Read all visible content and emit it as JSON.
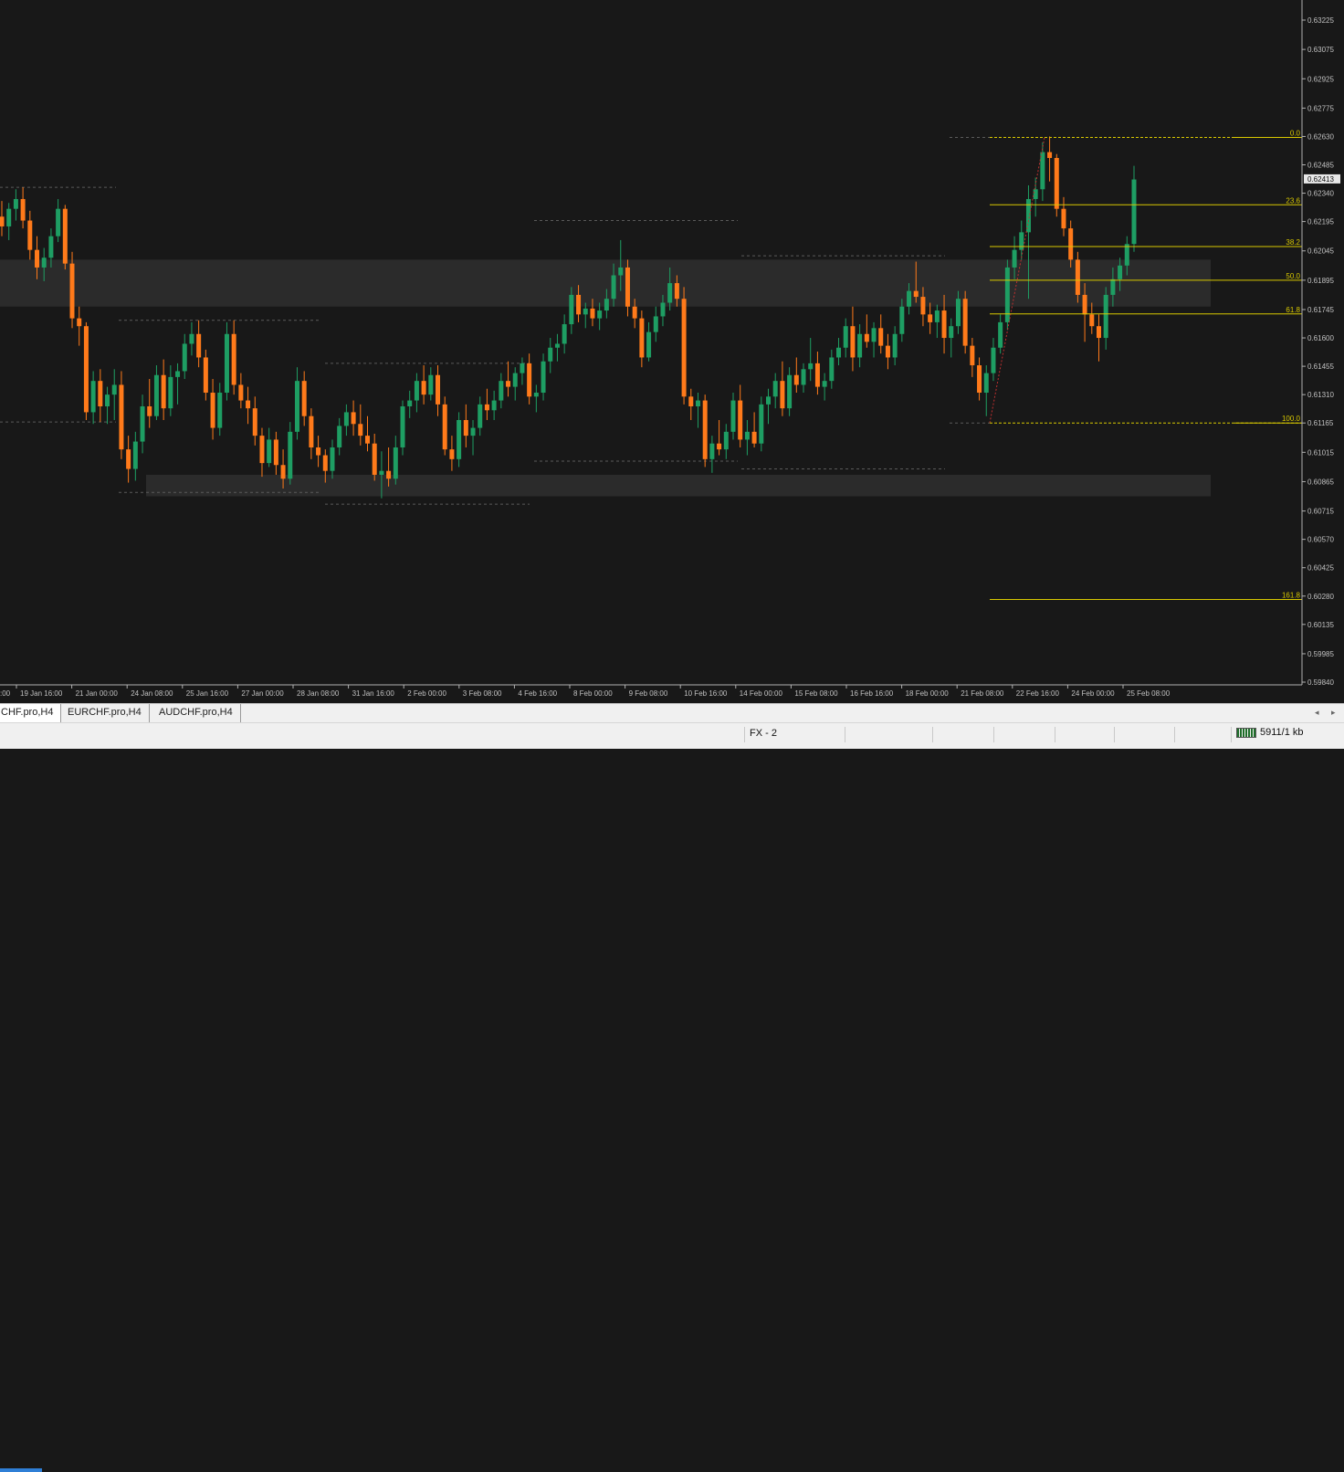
{
  "colors": {
    "background": "#181818",
    "bull": "#1e9e63",
    "bear": "#ff7a1a",
    "fib": "#d8c800",
    "zone": "#2b2b2b",
    "axis_text": "#c0c0c0",
    "price_marker_bg": "#e8e8e8"
  },
  "chart_data": {
    "type": "candlestick",
    "symbol_tabs_hint": "H4",
    "ylim": [
      0.5984,
      0.633
    ],
    "price_ticks": [
      "0.63225",
      "0.63075",
      "0.62925",
      "0.62775",
      "0.62630",
      "0.62485",
      "0.62340",
      "0.62195",
      "0.62045",
      "0.61895",
      "0.61745",
      "0.61600",
      "0.61455",
      "0.61310",
      "0.61165",
      "0.61015",
      "0.60865",
      "0.60715",
      "0.60570",
      "0.60425",
      "0.60280",
      "0.60135",
      "0.59985",
      "0.59840"
    ],
    "current_price": "0.62413",
    "time_labels": [
      "19 Jan 16:00",
      "21 Jan 00:00",
      "24 Jan 08:00",
      "25 Jan 16:00",
      "27 Jan 00:00",
      "28 Jan 08:00",
      "31 Jan 16:00",
      "2 Feb 00:00",
      "3 Feb 08:00",
      "4 Feb 16:00",
      "8 Feb 00:00",
      "9 Feb 08:00",
      "10 Feb 16:00",
      "14 Feb 00:00",
      "15 Feb 08:00",
      "16 Feb 16:00",
      "18 Feb 00:00",
      "21 Feb 08:00",
      "22 Feb 16:00",
      "24 Feb 00:00",
      "25 Feb 08:00"
    ],
    "first_time_label_fragment": ":00",
    "fibonacci": {
      "high": 0.62625,
      "low": 0.61165,
      "levels": [
        {
          "label": "0.0",
          "ratio": 0
        },
        {
          "label": "23.6",
          "ratio": 0.236
        },
        {
          "label": "38.2",
          "ratio": 0.382
        },
        {
          "label": "50.0",
          "ratio": 0.5
        },
        {
          "label": "61.8",
          "ratio": 0.618
        },
        {
          "label": "100.0",
          "ratio": 1.0
        },
        {
          "label": "161.8",
          "ratio": 1.618
        }
      ]
    },
    "zones": [
      {
        "name": "resistance-zone",
        "from": 0.6176,
        "to": 0.62
      },
      {
        "name": "support-zone",
        "from": 0.6079,
        "to": 0.609
      }
    ],
    "candles": [
      [
        0.6222,
        0.623,
        0.6212,
        0.6217
      ],
      [
        0.6217,
        0.6229,
        0.621,
        0.6226
      ],
      [
        0.6226,
        0.6236,
        0.622,
        0.6231
      ],
      [
        0.6231,
        0.6237,
        0.6216,
        0.622
      ],
      [
        0.622,
        0.6225,
        0.62,
        0.6205
      ],
      [
        0.6205,
        0.6212,
        0.619,
        0.6196
      ],
      [
        0.6196,
        0.6206,
        0.6189,
        0.6201
      ],
      [
        0.6201,
        0.6216,
        0.6196,
        0.6212
      ],
      [
        0.6212,
        0.6231,
        0.6209,
        0.6226
      ],
      [
        0.6226,
        0.6228,
        0.6195,
        0.6198
      ],
      [
        0.6198,
        0.6204,
        0.6165,
        0.617
      ],
      [
        0.617,
        0.6176,
        0.6156,
        0.6166
      ],
      [
        0.6166,
        0.6168,
        0.6118,
        0.6122
      ],
      [
        0.6122,
        0.6143,
        0.6116,
        0.6138
      ],
      [
        0.6138,
        0.6144,
        0.6117,
        0.6125
      ],
      [
        0.6125,
        0.6135,
        0.6116,
        0.6131
      ],
      [
        0.6131,
        0.6144,
        0.6118,
        0.6136
      ],
      [
        0.6136,
        0.6143,
        0.6098,
        0.6103
      ],
      [
        0.6103,
        0.611,
        0.6086,
        0.6093
      ],
      [
        0.6093,
        0.6112,
        0.6087,
        0.6107
      ],
      [
        0.6107,
        0.6131,
        0.6101,
        0.6125
      ],
      [
        0.6125,
        0.6139,
        0.6114,
        0.612
      ],
      [
        0.612,
        0.6146,
        0.6118,
        0.6141
      ],
      [
        0.6141,
        0.6149,
        0.6118,
        0.6124
      ],
      [
        0.6124,
        0.6146,
        0.612,
        0.614
      ],
      [
        0.614,
        0.6147,
        0.6126,
        0.6143
      ],
      [
        0.6143,
        0.6162,
        0.6139,
        0.6157
      ],
      [
        0.6157,
        0.6168,
        0.6151,
        0.6162
      ],
      [
        0.6162,
        0.6169,
        0.6145,
        0.615
      ],
      [
        0.615,
        0.6154,
        0.6128,
        0.6132
      ],
      [
        0.6132,
        0.6139,
        0.6108,
        0.6114
      ],
      [
        0.6114,
        0.6137,
        0.611,
        0.6132
      ],
      [
        0.6132,
        0.6168,
        0.6128,
        0.6162
      ],
      [
        0.6162,
        0.6169,
        0.6131,
        0.6136
      ],
      [
        0.6136,
        0.6142,
        0.6124,
        0.6128
      ],
      [
        0.6128,
        0.6135,
        0.6116,
        0.6124
      ],
      [
        0.6124,
        0.613,
        0.6105,
        0.611
      ],
      [
        0.611,
        0.6114,
        0.6089,
        0.6096
      ],
      [
        0.6096,
        0.6114,
        0.6094,
        0.6108
      ],
      [
        0.6108,
        0.6112,
        0.609,
        0.6095
      ],
      [
        0.6095,
        0.6103,
        0.6083,
        0.6088
      ],
      [
        0.6088,
        0.6117,
        0.6085,
        0.6112
      ],
      [
        0.6112,
        0.6145,
        0.6108,
        0.6138
      ],
      [
        0.6138,
        0.6143,
        0.6115,
        0.612
      ],
      [
        0.612,
        0.6124,
        0.6098,
        0.6104
      ],
      [
        0.6104,
        0.611,
        0.6094,
        0.61
      ],
      [
        0.61,
        0.6103,
        0.6086,
        0.6092
      ],
      [
        0.6092,
        0.6108,
        0.6088,
        0.6104
      ],
      [
        0.6104,
        0.6119,
        0.61,
        0.6115
      ],
      [
        0.6115,
        0.6126,
        0.611,
        0.6122
      ],
      [
        0.6122,
        0.6128,
        0.611,
        0.6116
      ],
      [
        0.6116,
        0.6126,
        0.6105,
        0.611
      ],
      [
        0.611,
        0.612,
        0.6102,
        0.6106
      ],
      [
        0.6106,
        0.6111,
        0.6087,
        0.609
      ],
      [
        0.609,
        0.6102,
        0.6078,
        0.6092
      ],
      [
        0.6092,
        0.6104,
        0.6084,
        0.6088
      ],
      [
        0.6088,
        0.611,
        0.6085,
        0.6104
      ],
      [
        0.6104,
        0.6128,
        0.61,
        0.6125
      ],
      [
        0.6125,
        0.6133,
        0.6119,
        0.6128
      ],
      [
        0.6128,
        0.6142,
        0.6122,
        0.6138
      ],
      [
        0.6138,
        0.6146,
        0.6126,
        0.6131
      ],
      [
        0.6131,
        0.6145,
        0.6128,
        0.6141
      ],
      [
        0.6141,
        0.6146,
        0.612,
        0.6126
      ],
      [
        0.6126,
        0.613,
        0.61,
        0.6103
      ],
      [
        0.6103,
        0.611,
        0.6092,
        0.6098
      ],
      [
        0.6098,
        0.6122,
        0.6094,
        0.6118
      ],
      [
        0.6118,
        0.6126,
        0.6104,
        0.611
      ],
      [
        0.611,
        0.6118,
        0.61,
        0.6114
      ],
      [
        0.6114,
        0.613,
        0.611,
        0.6126
      ],
      [
        0.6126,
        0.6134,
        0.6118,
        0.6123
      ],
      [
        0.6123,
        0.6133,
        0.6118,
        0.6128
      ],
      [
        0.6128,
        0.6142,
        0.6124,
        0.6138
      ],
      [
        0.6138,
        0.6148,
        0.613,
        0.6135
      ],
      [
        0.6135,
        0.6145,
        0.6128,
        0.6142
      ],
      [
        0.6142,
        0.615,
        0.6136,
        0.6147
      ],
      [
        0.6147,
        0.6152,
        0.6126,
        0.613
      ],
      [
        0.613,
        0.6136,
        0.6122,
        0.6132
      ],
      [
        0.6132,
        0.6152,
        0.6128,
        0.6148
      ],
      [
        0.6148,
        0.616,
        0.6142,
        0.6155
      ],
      [
        0.6155,
        0.6162,
        0.6148,
        0.6157
      ],
      [
        0.6157,
        0.6172,
        0.6152,
        0.6167
      ],
      [
        0.6167,
        0.6186,
        0.6162,
        0.6182
      ],
      [
        0.6182,
        0.6187,
        0.6168,
        0.6172
      ],
      [
        0.6172,
        0.6178,
        0.6165,
        0.6175
      ],
      [
        0.6175,
        0.618,
        0.6166,
        0.617
      ],
      [
        0.617,
        0.6178,
        0.6164,
        0.6174
      ],
      [
        0.6174,
        0.6185,
        0.617,
        0.618
      ],
      [
        0.618,
        0.6198,
        0.6176,
        0.6192
      ],
      [
        0.6192,
        0.621,
        0.6184,
        0.6196
      ],
      [
        0.6196,
        0.62,
        0.6171,
        0.6176
      ],
      [
        0.6176,
        0.618,
        0.6165,
        0.617
      ],
      [
        0.617,
        0.6174,
        0.6145,
        0.615
      ],
      [
        0.615,
        0.6168,
        0.6148,
        0.6163
      ],
      [
        0.6163,
        0.6176,
        0.6158,
        0.6171
      ],
      [
        0.6171,
        0.6182,
        0.6166,
        0.6178
      ],
      [
        0.6178,
        0.6196,
        0.6174,
        0.6188
      ],
      [
        0.6188,
        0.6192,
        0.6176,
        0.618
      ],
      [
        0.618,
        0.6186,
        0.6126,
        0.613
      ],
      [
        0.613,
        0.6134,
        0.6118,
        0.6125
      ],
      [
        0.6125,
        0.6132,
        0.6114,
        0.6128
      ],
      [
        0.6128,
        0.6131,
        0.6094,
        0.6098
      ],
      [
        0.6098,
        0.611,
        0.6091,
        0.6106
      ],
      [
        0.6106,
        0.6118,
        0.61,
        0.6103
      ],
      [
        0.6103,
        0.6116,
        0.6098,
        0.6112
      ],
      [
        0.6112,
        0.6132,
        0.6108,
        0.6128
      ],
      [
        0.6128,
        0.6136,
        0.6104,
        0.6108
      ],
      [
        0.6108,
        0.6118,
        0.61,
        0.6112
      ],
      [
        0.6112,
        0.6122,
        0.6104,
        0.6106
      ],
      [
        0.6106,
        0.613,
        0.6102,
        0.6126
      ],
      [
        0.6126,
        0.6134,
        0.6116,
        0.613
      ],
      [
        0.613,
        0.6142,
        0.6124,
        0.6138
      ],
      [
        0.6138,
        0.6148,
        0.612,
        0.6124
      ],
      [
        0.6124,
        0.6145,
        0.612,
        0.6141
      ],
      [
        0.6141,
        0.615,
        0.6132,
        0.6136
      ],
      [
        0.6136,
        0.6147,
        0.6132,
        0.6144
      ],
      [
        0.6144,
        0.616,
        0.6138,
        0.6147
      ],
      [
        0.6147,
        0.6153,
        0.6131,
        0.6135
      ],
      [
        0.6135,
        0.6142,
        0.6128,
        0.6138
      ],
      [
        0.6138,
        0.6154,
        0.6134,
        0.615
      ],
      [
        0.615,
        0.616,
        0.6146,
        0.6155
      ],
      [
        0.6155,
        0.617,
        0.615,
        0.6166
      ],
      [
        0.6166,
        0.6176,
        0.6143,
        0.615
      ],
      [
        0.615,
        0.6167,
        0.6145,
        0.6162
      ],
      [
        0.6162,
        0.6172,
        0.6155,
        0.6158
      ],
      [
        0.6158,
        0.6168,
        0.615,
        0.6165
      ],
      [
        0.6165,
        0.6172,
        0.6152,
        0.6156
      ],
      [
        0.6156,
        0.6162,
        0.6144,
        0.615
      ],
      [
        0.615,
        0.6166,
        0.6146,
        0.6162
      ],
      [
        0.6162,
        0.618,
        0.6158,
        0.6176
      ],
      [
        0.6176,
        0.6188,
        0.6172,
        0.6184
      ],
      [
        0.6184,
        0.6199,
        0.6178,
        0.6181
      ],
      [
        0.6181,
        0.6186,
        0.6166,
        0.6172
      ],
      [
        0.6172,
        0.6178,
        0.6162,
        0.6168
      ],
      [
        0.6168,
        0.6177,
        0.616,
        0.6174
      ],
      [
        0.6174,
        0.6182,
        0.6152,
        0.616
      ],
      [
        0.616,
        0.617,
        0.615,
        0.6166
      ],
      [
        0.6166,
        0.6184,
        0.6162,
        0.618
      ],
      [
        0.618,
        0.6184,
        0.6152,
        0.6156
      ],
      [
        0.6156,
        0.616,
        0.614,
        0.6146
      ],
      [
        0.6146,
        0.615,
        0.6128,
        0.6132
      ],
      [
        0.6132,
        0.6146,
        0.612,
        0.6142
      ],
      [
        0.6142,
        0.616,
        0.6138,
        0.6155
      ],
      [
        0.6155,
        0.6172,
        0.6152,
        0.6168
      ],
      [
        0.6168,
        0.62,
        0.6164,
        0.6196
      ],
      [
        0.6196,
        0.6212,
        0.619,
        0.6205
      ],
      [
        0.6205,
        0.622,
        0.62,
        0.6214
      ],
      [
        0.6214,
        0.6238,
        0.618,
        0.6231
      ],
      [
        0.6231,
        0.6242,
        0.6222,
        0.6236
      ],
      [
        0.6236,
        0.626,
        0.623,
        0.6255
      ],
      [
        0.6255,
        0.6263,
        0.624,
        0.6252
      ],
      [
        0.6252,
        0.6254,
        0.6222,
        0.6226
      ],
      [
        0.6226,
        0.6232,
        0.6212,
        0.6216
      ],
      [
        0.6216,
        0.622,
        0.6196,
        0.62
      ],
      [
        0.62,
        0.6204,
        0.6178,
        0.6182
      ],
      [
        0.6182,
        0.6188,
        0.6158,
        0.6172
      ],
      [
        0.6172,
        0.6178,
        0.6162,
        0.6166
      ],
      [
        0.6166,
        0.6172,
        0.6148,
        0.616
      ],
      [
        0.616,
        0.6186,
        0.6154,
        0.6182
      ],
      [
        0.6182,
        0.6196,
        0.6176,
        0.619
      ],
      [
        0.619,
        0.6201,
        0.6184,
        0.6197
      ],
      [
        0.6197,
        0.6212,
        0.6192,
        0.6208
      ],
      [
        0.6208,
        0.6248,
        0.6204,
        0.6241
      ]
    ]
  },
  "tabs": [
    {
      "label": "CHF.pro,H4",
      "active": true
    },
    {
      "label": "EURCHF.pro,H4",
      "active": false
    },
    {
      "label": "AUDCHF.pro,H4",
      "active": false
    }
  ],
  "tab_scroll_left": "◂",
  "tab_scroll_right": "▸",
  "status": {
    "profile": "FX - 2",
    "traffic": "5911/1 kb"
  }
}
